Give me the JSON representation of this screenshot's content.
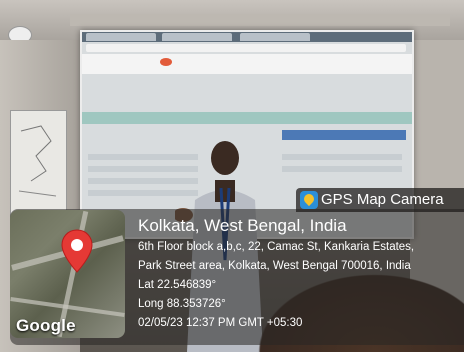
{
  "watermark": {
    "app_name": "GPS Map Camera",
    "app_icon": "map-pin-camera-icon",
    "title": "Kolkata, West Bengal, India",
    "address_line1": "6th Floor block a,b,c, 22, Camac St, Kankaria Estates,",
    "address_line2": "Park Street area, Kolkata, West Bengal 700016, India",
    "latitude": "Lat 22.546839°",
    "longitude": "Long 88.353726°",
    "datetime": "02/05/23 12:37 PM GMT +05:30",
    "map_attribution": "Google"
  },
  "colors": {
    "badge_icon": "#2b8fd8",
    "pin": "#e53935"
  }
}
